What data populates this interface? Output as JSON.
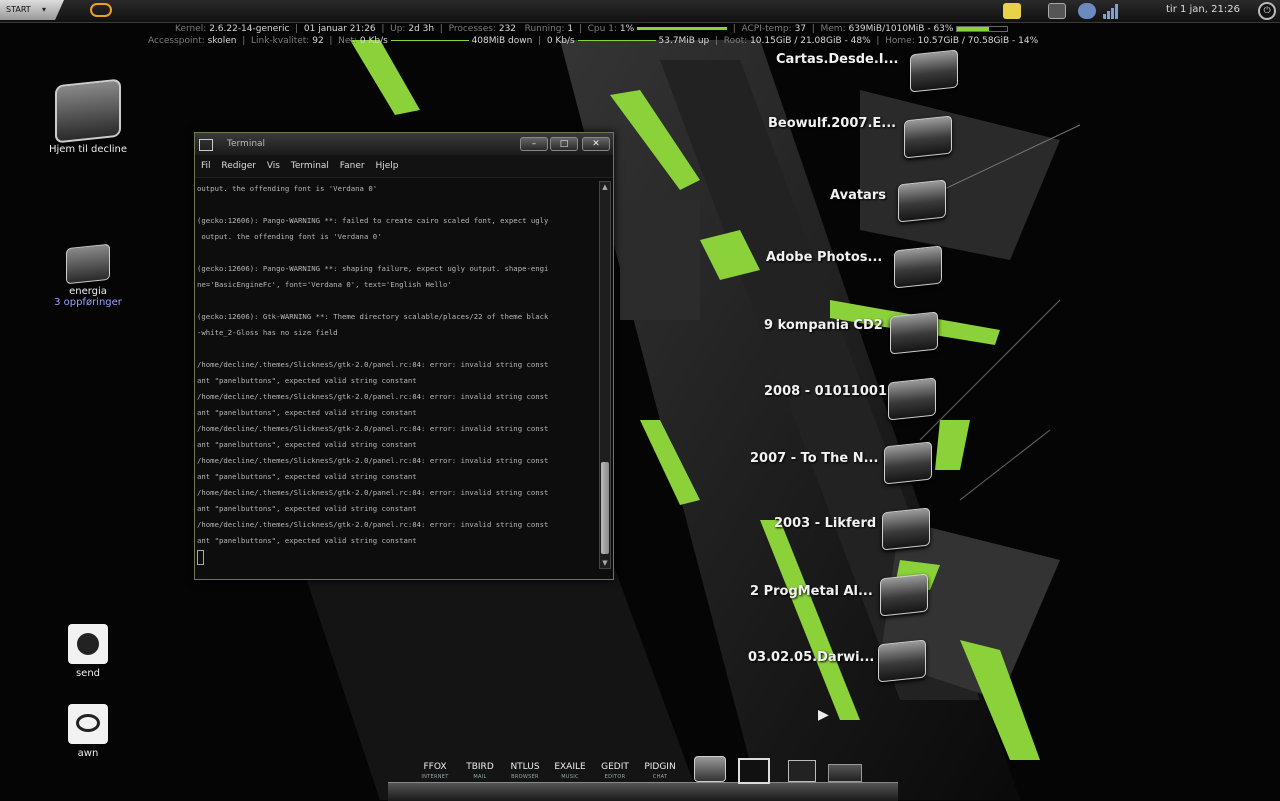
{
  "colors": {
    "accent": "#8ad13a",
    "background": "#050505"
  },
  "top_panel": {
    "start_label": "START",
    "clock": "tir  1 jan, 21:26",
    "icons": [
      "start-arrow-icon",
      "notes-icon",
      "mail-icon",
      "users-icon",
      "wifi-icon",
      "power-icon"
    ]
  },
  "conky": {
    "line1": {
      "kernel_label": "Kernel:",
      "kernel": "2.6.22-14-generic",
      "date": "01 januar 21:26",
      "uptime_label": "Up:",
      "uptime": "2d 3h",
      "processes_label": "Processes:",
      "processes": "232",
      "running_label": "Running:",
      "running": "1",
      "cpu_label": "Cpu 1:",
      "cpu": "1%",
      "acpi_label": "ACPI-temp:",
      "acpi": "37",
      "mem_label": "Mem:",
      "mem": "639MiB/1010MiB - 63%",
      "mem_fraction": 0.63
    },
    "line2": {
      "ap_label": "Accesspoint:",
      "ap": "skolen",
      "link_label": "Link-kvalitet:",
      "link": "92",
      "net_label": "Net:",
      "down_rate": "0 Kb/s",
      "down_total": "408MiB down",
      "up_rate": "0 Kb/s",
      "up_total": "53.7MiB up",
      "root_label": "Root:",
      "root": "10.15GiB / 21.08GiB - 48%",
      "home_label": "Home:",
      "home": "10.57GiB / 70.58GiB - 14%"
    }
  },
  "desktop_left": [
    {
      "label": "Hjem til decline",
      "sub": ""
    },
    {
      "label": "energia",
      "sub": "3 oppføringer"
    },
    {
      "label": "send",
      "sub": ""
    },
    {
      "label": "awn",
      "sub": ""
    }
  ],
  "desktop_right": [
    "Cartas.Desde.I...",
    "Beowulf.2007.E...",
    "Avatars",
    "Adobe Photos...",
    "9 kompania CD2",
    "2008 - 01011001",
    "2007 - To The N...",
    "2003 - Likferd",
    "2 ProgMetal Al...",
    "03.02.05.Darwi..."
  ],
  "terminal": {
    "title": "Terminal",
    "menu": [
      "Fil",
      "Rediger",
      "Vis",
      "Terminal",
      "Faner",
      "Hjelp"
    ],
    "lines": [
      "output. the offending font is 'Verdana 0'",
      "",
      "(gecko:12606): Pango-WARNING **: failed to create cairo scaled font, expect ugly",
      " output. the offending font is 'Verdana 0'",
      "",
      "(gecko:12606): Pango-WARNING **: shaping failure, expect ugly output. shape-engi",
      "ne='BasicEngineFc', font='Verdana 0', text='English Hello'",
      "",
      "(gecko:12606): Gtk-WARNING **: Theme directory scalable/places/22 of theme black",
      "-white_2-Gloss has no size field",
      "",
      "/home/decline/.themes/SlicknesS/gtk-2.0/panel.rc:84: error: invalid string const",
      "ant \"panelbuttons\", expected valid string constant",
      "/home/decline/.themes/SlicknesS/gtk-2.0/panel.rc:84: error: invalid string const",
      "ant \"panelbuttons\", expected valid string constant",
      "/home/decline/.themes/SlicknesS/gtk-2.0/panel.rc:84: error: invalid string const",
      "ant \"panelbuttons\", expected valid string constant",
      "/home/decline/.themes/SlicknesS/gtk-2.0/panel.rc:84: error: invalid string const",
      "ant \"panelbuttons\", expected valid string constant",
      "/home/decline/.themes/SlicknesS/gtk-2.0/panel.rc:84: error: invalid string const",
      "ant \"panelbuttons\", expected valid string constant",
      "/home/decline/.themes/SlicknesS/gtk-2.0/panel.rc:84: error: invalid string const",
      "ant \"panelbuttons\", expected valid string constant"
    ],
    "buttons": {
      "minimize": "–",
      "maximize": "□",
      "close": "✕"
    }
  },
  "dock": {
    "launchers": [
      {
        "name": "FFOX",
        "sub": "INTERNET"
      },
      {
        "name": "TBIRD",
        "sub": "MAIL"
      },
      {
        "name": "NTLUS",
        "sub": "BROWSER"
      },
      {
        "name": "EXAILE",
        "sub": "MUSIC"
      },
      {
        "name": "GEDIT",
        "sub": "EDITOR"
      },
      {
        "name": "PIDGIN",
        "sub": "CHAT"
      }
    ]
  }
}
